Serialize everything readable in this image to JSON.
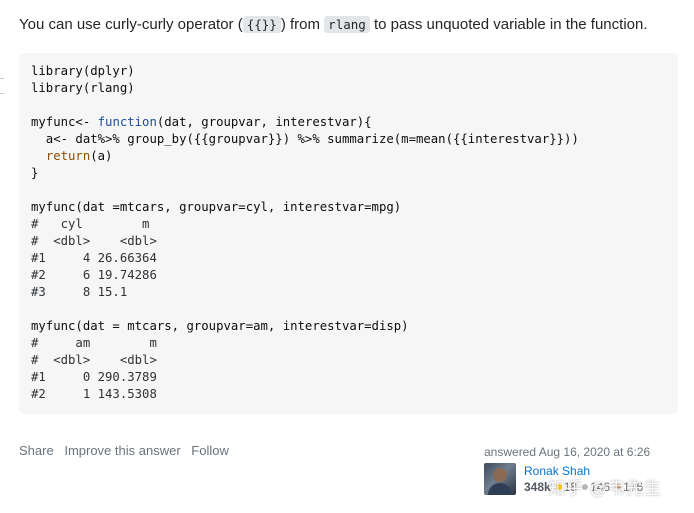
{
  "answer": {
    "intro": {
      "text_before": "You can use curly-curly operator (",
      "code_curly": "{{}}",
      "text_middle": ") from ",
      "code_pkg": "rlang",
      "text_after": " to pass unquoted variable in the function."
    },
    "code_lines": [
      [
        {
          "t": "library(dplyr)",
          "c": ""
        }
      ],
      [
        {
          "t": "library(rlang)",
          "c": ""
        }
      ],
      [
        {
          "t": "",
          "c": ""
        }
      ],
      [
        {
          "t": "myfunc<- ",
          "c": ""
        },
        {
          "t": "function",
          "c": "kw"
        },
        {
          "t": "(dat, groupvar, interestvar){",
          "c": ""
        }
      ],
      [
        {
          "t": "  a<- dat%>% group_by({{groupvar}}) %>% summarize(m=mean({{interestvar}}))",
          "c": ""
        }
      ],
      [
        {
          "t": "  ",
          "c": ""
        },
        {
          "t": "return",
          "c": "fn"
        },
        {
          "t": "(a)",
          "c": ""
        }
      ],
      [
        {
          "t": "}",
          "c": ""
        }
      ],
      [
        {
          "t": "",
          "c": ""
        }
      ],
      [
        {
          "t": "myfunc(dat =mtcars, groupvar=cyl, interestvar=mpg)",
          "c": ""
        }
      ],
      [
        {
          "t": "#   cyl        m",
          "c": "cm"
        }
      ],
      [
        {
          "t": "#  <dbl>    <dbl>",
          "c": "cm"
        }
      ],
      [
        {
          "t": "#1     4 26.66364",
          "c": "cm"
        }
      ],
      [
        {
          "t": "#2     6 19.74286",
          "c": "cm"
        }
      ],
      [
        {
          "t": "#3     8 15.1",
          "c": "cm"
        }
      ],
      [
        {
          "t": "",
          "c": ""
        }
      ],
      [
        {
          "t": "myfunc(dat = mtcars, groupvar=am, interestvar=disp)",
          "c": ""
        }
      ],
      [
        {
          "t": "#     am        m",
          "c": "cm"
        }
      ],
      [
        {
          "t": "#  <dbl>    <dbl>",
          "c": "cm"
        }
      ],
      [
        {
          "t": "#1     0 290.3789",
          "c": "cm"
        }
      ],
      [
        {
          "t": "#2     1 143.5308",
          "c": "cm"
        }
      ]
    ]
  },
  "post_menu": {
    "share": "Share",
    "improve": "Improve this answer",
    "follow": "Follow"
  },
  "signature": {
    "action": "answered Aug 16, 2020 at 6:26",
    "user_name": "Ronak Shah",
    "reputation": "348k",
    "gold": "18",
    "silver": "146",
    "bronze": "176"
  },
  "watermark": "知乎 @韦先生",
  "colors": {
    "code_background": "#f6f6f6",
    "keyword": "#1b4f9c",
    "link": "#0074cc",
    "muted": "#6a737c"
  }
}
